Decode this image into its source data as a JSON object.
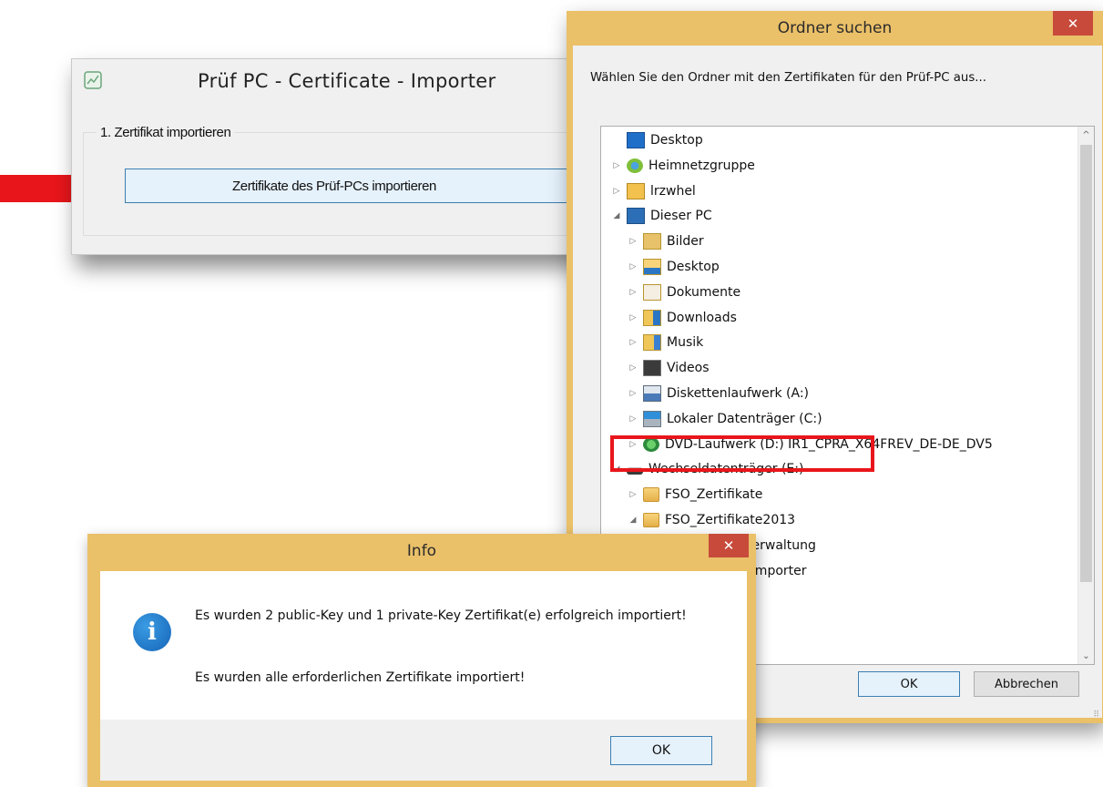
{
  "importer": {
    "title": "Prüf PC - Certificate - Importer",
    "group_label": "1. Zertifikat importieren",
    "import_button": "Zertifikate des Prüf-PCs importieren"
  },
  "folder_dialog": {
    "title": "Ordner suchen",
    "close_glyph": "✕",
    "prompt": "Wählen Sie den Ordner mit den Zertifikaten für den Prüf-PC aus...",
    "tree": [
      {
        "label": "Desktop",
        "icon": "desktop-icon",
        "expander": ""
      },
      {
        "label": "Heimnetzgruppe",
        "icon": "homegroup-icon",
        "expander": "▷"
      },
      {
        "label": "lrzwhel",
        "icon": "user-icon",
        "expander": "▷"
      },
      {
        "label": "Dieser PC",
        "icon": "computer-icon",
        "expander": "◢"
      },
      {
        "label": "Bilder",
        "icon": "pictures-folder-icon",
        "expander": "▷"
      },
      {
        "label": "Desktop",
        "icon": "desktop-folder-icon",
        "expander": "▷"
      },
      {
        "label": "Dokumente",
        "icon": "documents-folder-icon",
        "expander": "▷"
      },
      {
        "label": "Downloads",
        "icon": "downloads-folder-icon",
        "expander": "▷"
      },
      {
        "label": "Musik",
        "icon": "music-folder-icon",
        "expander": "▷"
      },
      {
        "label": "Videos",
        "icon": "videos-folder-icon",
        "expander": "▷"
      },
      {
        "label": "Diskettenlaufwerk (A:)",
        "icon": "floppy-drive-icon",
        "expander": "▷"
      },
      {
        "label": "Lokaler Datenträger (C:)",
        "icon": "local-disk-icon",
        "expander": "▷"
      },
      {
        "label": "DVD-Laufwerk (D:) IR1_CPRA_X64FREV_DE-DE_DV5",
        "icon": "dvd-drive-icon",
        "expander": "▷"
      },
      {
        "label": "Wechseldatenträger (E:)",
        "icon": "removable-drive-icon",
        "expander": "◢"
      },
      {
        "label": "FSO_Zertifikate",
        "icon": "folder-icon",
        "expander": "▷"
      },
      {
        "label": "FSO_Zertifikate2013",
        "icon": "folder-icon",
        "expander": "◢"
      },
      {
        "label": "FahrpruefVerwaltung",
        "icon": "folder-icon",
        "expander": ""
      },
      {
        "label": "ateImporter",
        "icon": "",
        "expander": ""
      }
    ],
    "ok_label": "OK",
    "cancel_label": "Abbrechen"
  },
  "info_dialog": {
    "title": "Info",
    "close_glyph": "✕",
    "icon_glyph": "i",
    "message_line1": "Es wurden 2 public-Key und 1 private-Key Zertifikat(e) erfolgreich importiert!",
    "message_line2": "Es wurden alle erforderlichen Zertifikate importiert!",
    "ok_label": "OK"
  },
  "scroll_glyphs": {
    "up": "^",
    "down": "⌄"
  },
  "colors": {
    "dialog_frame": "#eac069",
    "close_button": "#c74a3b",
    "highlight": "#e8161b",
    "arrow": "#e8161b",
    "button_focus_border": "#3c7fb1"
  }
}
